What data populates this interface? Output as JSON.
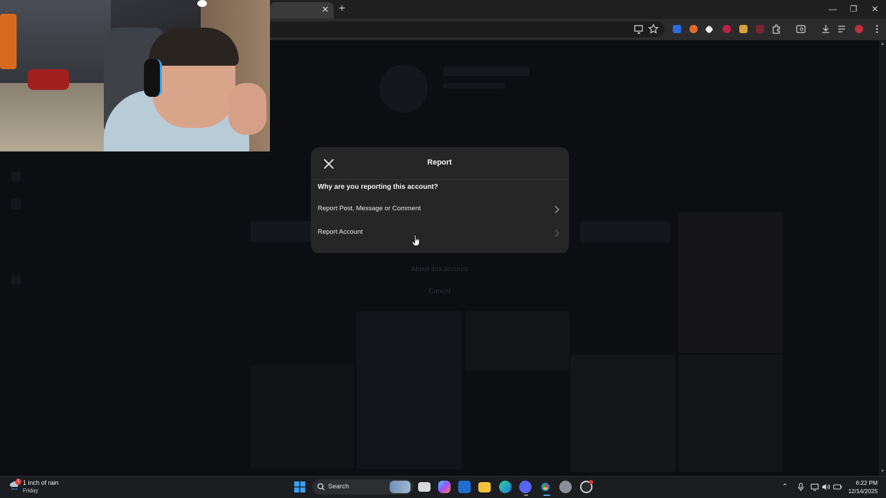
{
  "browser": {
    "tab_close_glyph": "✕",
    "new_tab_glyph": "+",
    "window_controls": [
      "—",
      "❐",
      "✕"
    ],
    "toolbar_icons": [
      "install-icon",
      "star-icon",
      "extensions-icon",
      "download-icon",
      "menu-icon"
    ]
  },
  "modal": {
    "title": "Report",
    "question": "Why are you reporting this account?",
    "options": [
      {
        "label": "Report Post, Message or Comment"
      },
      {
        "label": "Report Account"
      }
    ]
  },
  "background_dialog": {
    "about": "About this account",
    "cancel": "Cancel"
  },
  "taskbar": {
    "weather": {
      "title": "1 inch of rain",
      "day": "Friday",
      "badge": "1"
    },
    "search_label": "Search",
    "clock": {
      "time": "6:22 PM",
      "date": "12/14/2025"
    }
  }
}
